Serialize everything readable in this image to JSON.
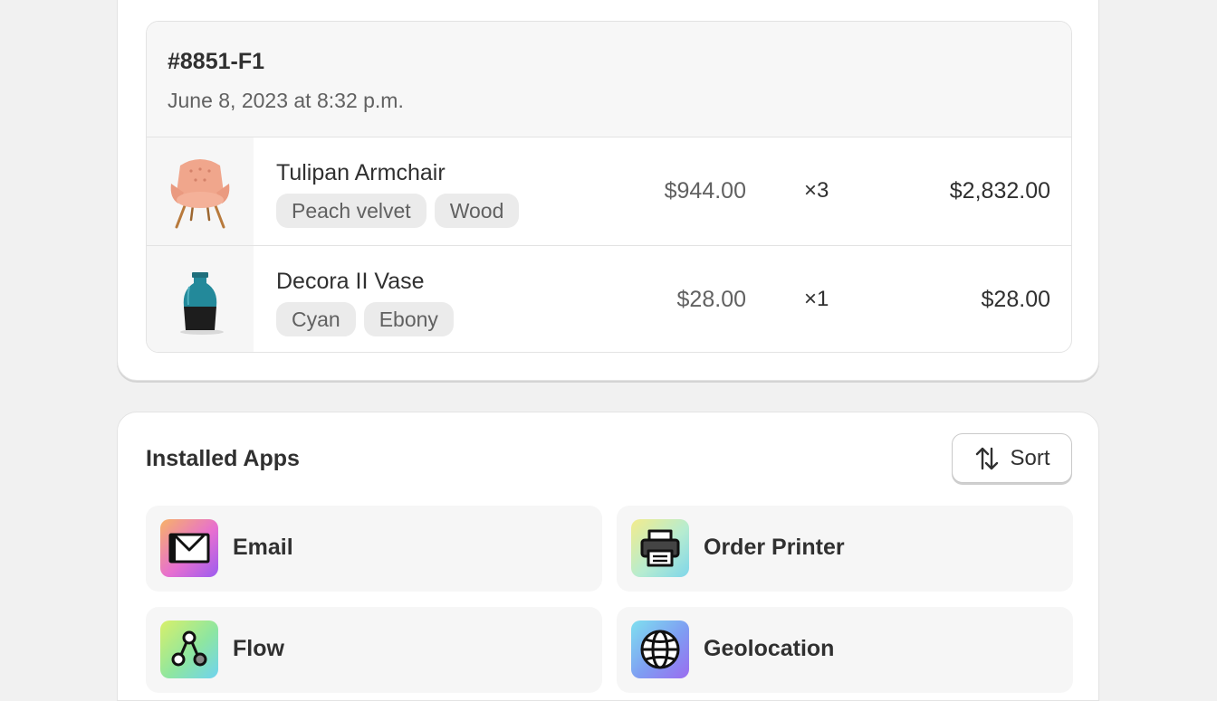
{
  "order": {
    "id": "#8851-F1",
    "date": "June 8, 2023 at 8:32 p.m.",
    "items": [
      {
        "name": "Tulipan Armchair",
        "tags": [
          "Peach velvet",
          "Wood"
        ],
        "price": "$944.00",
        "qty": "×3",
        "total": "$2,832.00",
        "image_icon": "armchair-image"
      },
      {
        "name": "Decora II Vase",
        "tags": [
          "Cyan",
          "Ebony"
        ],
        "price": "$28.00",
        "qty": "×1",
        "total": "$28.00",
        "image_icon": "vase-image"
      }
    ]
  },
  "installed_apps": {
    "title": "Installed Apps",
    "sort_label": "Sort",
    "sort_icon": "sort-arrows-icon",
    "apps": [
      {
        "label": "Email",
        "icon": "envelope-icon"
      },
      {
        "label": "Order Printer",
        "icon": "printer-icon"
      },
      {
        "label": "Flow",
        "icon": "flow-nodes-icon"
      },
      {
        "label": "Geolocation",
        "icon": "globe-icon"
      }
    ]
  },
  "colors": {
    "page_background": "#f1f1f1",
    "card_background": "#ffffff",
    "tile_background": "#f6f6f6",
    "text_primary": "#303030",
    "text_secondary": "#616161"
  }
}
